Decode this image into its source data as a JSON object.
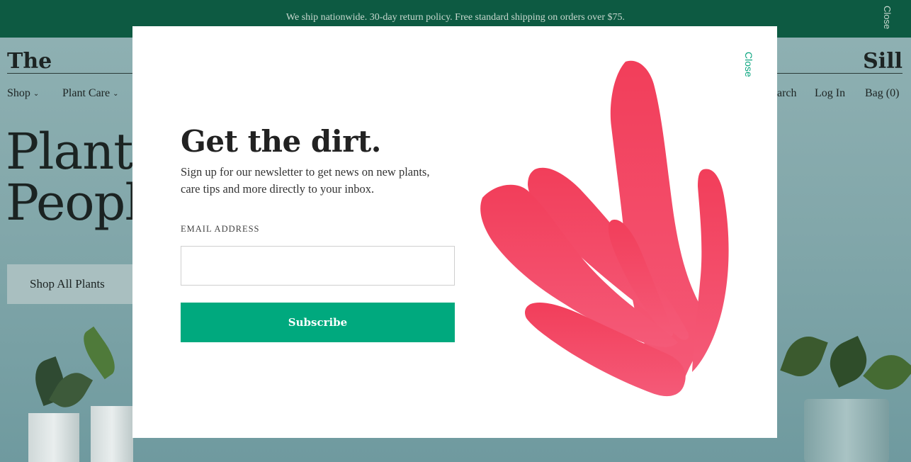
{
  "announcement": {
    "text": "We ship nationwide. 30-day return policy. Free standard shipping on orders over $75.",
    "close_label": "Close"
  },
  "site": {
    "logo_left": "The",
    "logo_right": "Sill"
  },
  "nav": {
    "left": [
      {
        "label": "Shop",
        "has_dropdown": true
      },
      {
        "label": "Plant Care",
        "has_dropdown": true
      }
    ],
    "right": [
      {
        "label": "arch"
      },
      {
        "label": "Log In"
      },
      {
        "label": "Bag (0)"
      }
    ]
  },
  "hero": {
    "headline_line1": "Plants",
    "headline_line2": "People",
    "cta_label": "Shop All Plants"
  },
  "modal": {
    "close_label": "Close",
    "title": "Get the dirt.",
    "copy": "Sign up for our newsletter to get news on new plants, care tips and more directly to your inbox.",
    "email_label": "EMAIL ADDRESS",
    "email_value": "",
    "email_placeholder": "",
    "subscribe_label": "Subscribe",
    "illustration": "coral-leaf-illustration"
  },
  "colors": {
    "announcement_bg": "#0d5a42",
    "accent_green": "#00a97e",
    "leaf_pink": "#f2455f",
    "overlay_teal": "#8fb0b3"
  }
}
